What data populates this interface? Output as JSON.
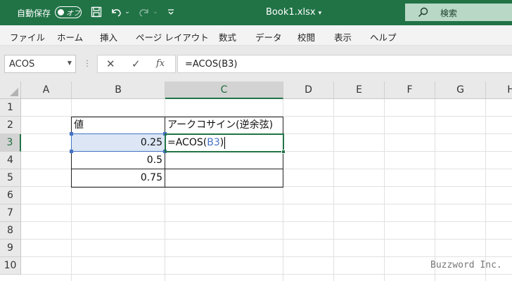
{
  "titlebar": {
    "autosave_label": "自動保存",
    "autosave_state": "オフ",
    "file_name": "Book1.xlsx",
    "search_placeholder": "検索",
    "accent_color": "#217346"
  },
  "ribbon": {
    "tabs": [
      "ファイル",
      "ホーム",
      "挿入",
      "ページ レイアウト",
      "数式",
      "データ",
      "校閲",
      "表示",
      "ヘルプ"
    ]
  },
  "formula_bar": {
    "name_box": "ACOS",
    "cancel_label": "✕",
    "enter_label": "✓",
    "fx_label": "fx",
    "formula": "=ACOS(B3)"
  },
  "grid": {
    "columns": [
      "A",
      "B",
      "C",
      "D",
      "E",
      "F",
      "G",
      "H"
    ],
    "rows": [
      "1",
      "2",
      "3",
      "4",
      "5",
      "6",
      "7",
      "8",
      "9",
      "10"
    ],
    "selected_column": "C",
    "selected_row": "3",
    "cells": {
      "B2": "値",
      "C2": "アークコサイン(逆余弦)",
      "B3": "0.25",
      "B4": "0.5",
      "B5": "0.75",
      "C3_prefix": "=ACOS(",
      "C3_ref": "B3",
      "C3_suffix": ")"
    }
  },
  "watermark": "Buzzword Inc."
}
